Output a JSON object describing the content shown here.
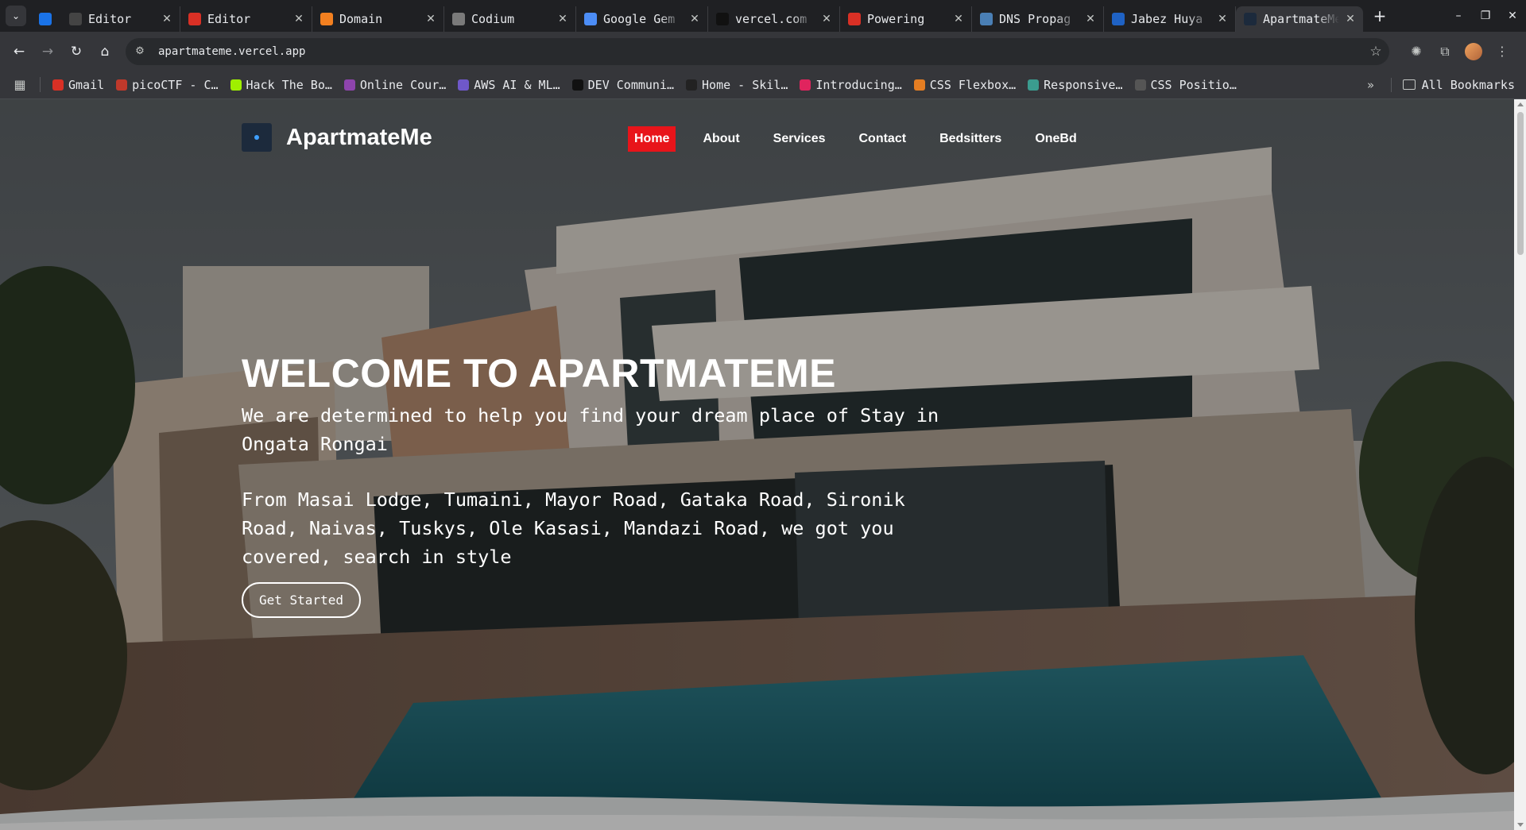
{
  "browser": {
    "tabs": [
      {
        "title": "",
        "icon": "terminal-icon",
        "color": "#1a73e8",
        "pinned": true
      },
      {
        "title": "Editor",
        "icon": "jc-icon",
        "color": "#444444"
      },
      {
        "title": "Editor",
        "icon": "gmail-icon",
        "color": "#d93025"
      },
      {
        "title": "Domain",
        "icon": "cloudflare-icon",
        "color": "#f38020"
      },
      {
        "title": "Codium",
        "icon": "codium-icon",
        "color": "#7a7a7a"
      },
      {
        "title": "Google Gem",
        "icon": "gemini-icon",
        "color": "#4c8df6"
      },
      {
        "title": "vercel.com",
        "icon": "vercel-icon",
        "color": "#111111"
      },
      {
        "title": "Powering",
        "icon": "powering-icon",
        "color": "#d93025"
      },
      {
        "title": "DNS Propag",
        "icon": "dns-icon",
        "color": "#4a7fb5"
      },
      {
        "title": "Jabez Huya",
        "icon": "jabez-icon",
        "color": "#1f62c4"
      },
      {
        "title": "ApartmateMe",
        "icon": "apartmateme-icon",
        "color": "#1c2a3c",
        "active": true
      }
    ],
    "url": "apartmateme.vercel.app",
    "bookmarks": [
      {
        "label": "Gmail",
        "icon": "gmail-icon",
        "color": "#d93025"
      },
      {
        "label": "picoCTF - C…",
        "icon": "picoctf-icon",
        "color": "#c0392b"
      },
      {
        "label": "Hack The Bo…",
        "icon": "hackthebox-icon",
        "color": "#9fef00"
      },
      {
        "label": "Online Cour…",
        "icon": "online-course-icon",
        "color": "#8e44ad"
      },
      {
        "label": "AWS AI & ML…",
        "icon": "aws-icon",
        "color": "#6f58c9"
      },
      {
        "label": "DEV Communi…",
        "icon": "dev-icon",
        "color": "#111111"
      },
      {
        "label": "Home - Skil…",
        "icon": "skill-icon",
        "color": "#222222"
      },
      {
        "label": "Introducing…",
        "icon": "ig-icon",
        "color": "#e0245e"
      },
      {
        "label": "CSS Flexbox…",
        "icon": "flexbox-icon",
        "color": "#e67e22"
      },
      {
        "label": "Responsive…",
        "icon": "responsive-icon",
        "color": "#3b9c8f"
      },
      {
        "label": "CSS Positio…",
        "icon": "css-position-icon",
        "color": "#555555"
      }
    ],
    "all_bookmarks": "All Bookmarks"
  },
  "site": {
    "logo_text": "ApartmateMe",
    "nav": [
      {
        "label": "Home",
        "active": true
      },
      {
        "label": "About"
      },
      {
        "label": "Services"
      },
      {
        "label": "Contact"
      },
      {
        "label": "Bedsitters"
      },
      {
        "label": "OneBd"
      }
    ],
    "hero": {
      "heading": "WELCOME TO APARTMATEME",
      "lead": "We are determined to help you find your dream place of Stay in Ongata Rongai",
      "sub": "From Masai Lodge, Tumaini, Mayor Road, Gataka Road, Sironik Road, Naivas, Tuskys, Ole Kasasi, Mandazi Road, we got you covered, search in style",
      "cta": "Get Started"
    },
    "accent_color": "#e8141a"
  }
}
